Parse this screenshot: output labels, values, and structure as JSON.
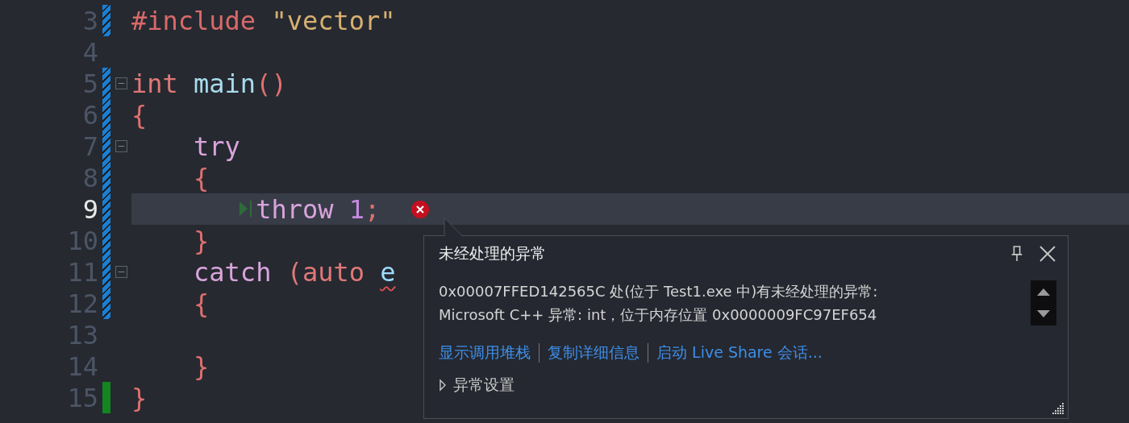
{
  "editor": {
    "lines": [
      {
        "number": "3",
        "color": "#1a7fd4",
        "saved": false,
        "current": false,
        "tokens": [
          {
            "text": "#include ",
            "kind": "directive"
          },
          {
            "text": "\"vector\"",
            "kind": "string"
          }
        ]
      },
      {
        "number": "4",
        "current": false
      },
      {
        "number": "5",
        "color": "#1a7fd4",
        "saved": false,
        "fold": true,
        "current": false,
        "tokens": [
          {
            "text": "int ",
            "kind": "keyword"
          },
          {
            "text": "main",
            "kind": "function"
          },
          {
            "text": "()",
            "kind": "punct"
          }
        ]
      },
      {
        "number": "6",
        "color": "#1a7fd4",
        "saved": false,
        "current": false,
        "tokens": [
          {
            "text": "{",
            "kind": "punct"
          }
        ]
      },
      {
        "number": "7",
        "color": "#1a7fd4",
        "saved": false,
        "fold": true,
        "current": false,
        "tokens": [
          {
            "text": "    try",
            "kind": "control"
          }
        ]
      },
      {
        "number": "8",
        "color": "#1a7fd4",
        "saved": false,
        "current": false,
        "tokens": [
          {
            "text": "    {",
            "kind": "punct"
          }
        ]
      },
      {
        "number": "9",
        "color": "#1a7fd4",
        "saved": false,
        "current": true,
        "error": true,
        "tokens": [
          {
            "text": "        throw ",
            "kind": "control"
          },
          {
            "text": "1",
            "kind": "number"
          },
          {
            "text": ";",
            "kind": "punct"
          }
        ]
      },
      {
        "number": "10",
        "color": "#1a7fd4",
        "saved": false,
        "current": false,
        "tokens": [
          {
            "text": "    }",
            "kind": "punct"
          }
        ]
      },
      {
        "number": "11",
        "color": "#1a7fd4",
        "saved": false,
        "fold": true,
        "current": false,
        "tokens": [
          {
            "text": "    catch ",
            "kind": "control"
          },
          {
            "text": "(auto ",
            "kind": "keyword"
          },
          {
            "text": "e",
            "kind": "variable",
            "squiggle": true
          }
        ]
      },
      {
        "number": "12",
        "color": "#1a7fd4",
        "saved": false,
        "current": false,
        "tokens": [
          {
            "text": "    {",
            "kind": "punct"
          }
        ]
      },
      {
        "number": "13",
        "current": false
      },
      {
        "number": "14",
        "current": false,
        "tokens": [
          {
            "text": "    }",
            "kind": "punct"
          }
        ]
      },
      {
        "number": "15",
        "color": "#13861f",
        "saved": true,
        "current": false,
        "tokens": [
          {
            "text": "}",
            "kind": "punct"
          }
        ]
      }
    ]
  },
  "exception_popup": {
    "title": "未经处理的异常",
    "message": [
      "0x00007FFED142565C 处(位于 Test1.exe 中)有未经处理的异常:",
      "Microsoft C++ 异常: int，位于内存位置 0x0000009FC97EF654"
    ],
    "links": [
      "显示调用堆栈",
      "复制详细信息",
      "启动 Live Share 会话..."
    ],
    "settings": {
      "label": "异常设置",
      "expanded": false
    }
  }
}
